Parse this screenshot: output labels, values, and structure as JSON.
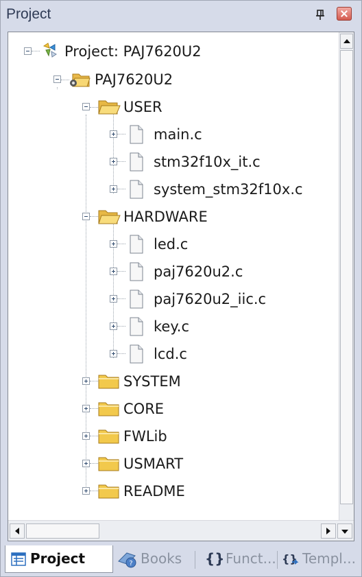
{
  "panel": {
    "title": "Project"
  },
  "tree": [
    {
      "label": "Project: PAJ7620U2",
      "icon": "project-root-icon",
      "expander": "minus"
    },
    {
      "label": "PAJ7620U2",
      "icon": "target-folder-icon",
      "expander": "minus"
    },
    {
      "label": "USER",
      "icon": "folder-open-icon",
      "expander": "minus"
    },
    {
      "label": "main.c",
      "icon": "file-icon",
      "expander": "plus"
    },
    {
      "label": "stm32f10x_it.c",
      "icon": "file-icon",
      "expander": "plus"
    },
    {
      "label": "system_stm32f10x.c",
      "icon": "file-icon",
      "expander": "plus"
    },
    {
      "label": "HARDWARE",
      "icon": "folder-open-icon",
      "expander": "minus"
    },
    {
      "label": "led.c",
      "icon": "file-icon",
      "expander": "plus"
    },
    {
      "label": "paj7620u2.c",
      "icon": "file-icon",
      "expander": "plus"
    },
    {
      "label": "paj7620u2_iic.c",
      "icon": "file-icon",
      "expander": "plus"
    },
    {
      "label": "key.c",
      "icon": "file-icon",
      "expander": "plus"
    },
    {
      "label": "lcd.c",
      "icon": "file-icon",
      "expander": "plus"
    },
    {
      "label": "SYSTEM",
      "icon": "folder-closed-icon",
      "expander": "plus"
    },
    {
      "label": "CORE",
      "icon": "folder-closed-icon",
      "expander": "plus"
    },
    {
      "label": "FWLib",
      "icon": "folder-closed-icon",
      "expander": "plus"
    },
    {
      "label": "USMART",
      "icon": "folder-closed-icon",
      "expander": "plus"
    },
    {
      "label": "README",
      "icon": "folder-closed-icon",
      "expander": "plus"
    }
  ],
  "tabs": [
    {
      "label": "Project",
      "icon": "project-tab-icon",
      "active": true
    },
    {
      "label": "Books",
      "icon": "books-tab-icon",
      "active": false
    },
    {
      "label": "Funct...",
      "icon": "functions-tab-icon",
      "active": false
    },
    {
      "label": "Templ...",
      "icon": "templates-tab-icon",
      "active": false
    }
  ],
  "colors": {
    "panel_bg": "#d6dbe9",
    "tree_bg": "#ffffff",
    "folder": "#f5d36a",
    "close": "#d45b4f"
  }
}
